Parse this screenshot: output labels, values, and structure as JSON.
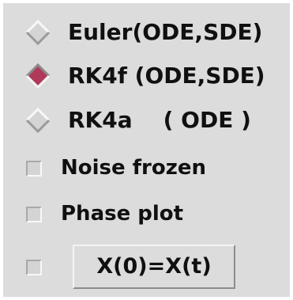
{
  "integrator": {
    "options": [
      {
        "label": "Euler(ODE,SDE)",
        "selected": false
      },
      {
        "label": "RK4f (ODE,SDE)",
        "selected": true
      },
      {
        "label": "RK4a    ( ODE )",
        "selected": false
      }
    ],
    "selected_color": "#b03a5a"
  },
  "options": {
    "noise_frozen": {
      "label": "Noise frozen",
      "checked": false
    },
    "phase_plot": {
      "label": "Phase plot",
      "checked": false
    },
    "reset_check": {
      "checked": false
    }
  },
  "button": {
    "label": "X(0)=X(t)"
  }
}
